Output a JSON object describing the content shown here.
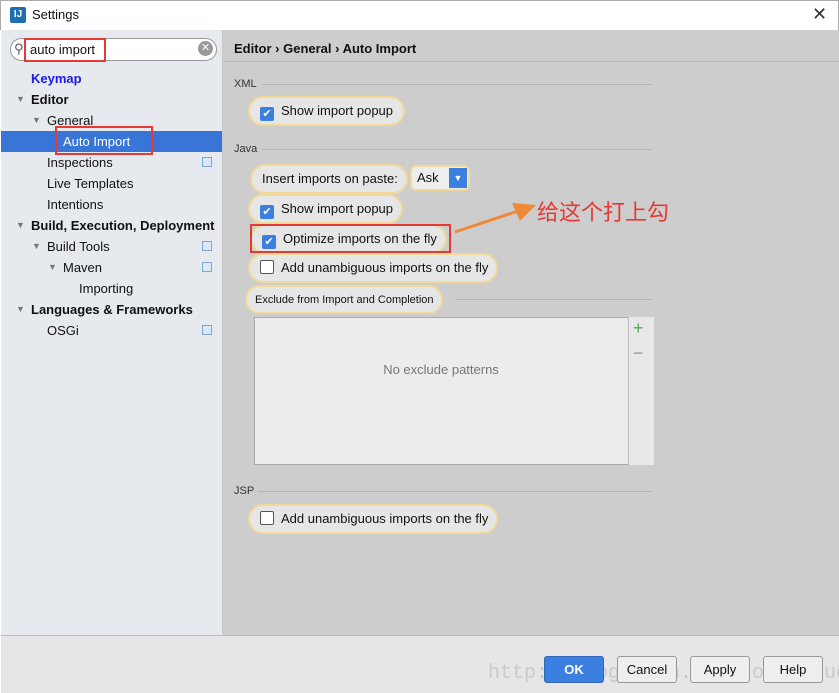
{
  "window": {
    "title": "Settings",
    "close": "✕"
  },
  "search": {
    "value": "auto import"
  },
  "sidebar": {
    "items": [
      {
        "label": "Keymap"
      },
      {
        "label": "Editor"
      },
      {
        "label": "General"
      },
      {
        "label": "Auto Import"
      },
      {
        "label": "Inspections"
      },
      {
        "label": "Live Templates"
      },
      {
        "label": "Intentions"
      },
      {
        "label": "Build, Execution, Deployment"
      },
      {
        "label": "Build Tools"
      },
      {
        "label": "Maven"
      },
      {
        "label": "Importing"
      },
      {
        "label": "Languages & Frameworks"
      },
      {
        "label": "OSGi"
      }
    ]
  },
  "breadcrumb": "Editor › General › Auto Import",
  "xml": {
    "label": "XML",
    "show_popup": {
      "label": "Show import popup",
      "checked": true
    }
  },
  "java": {
    "label": "Java",
    "insert_label": "Insert imports on paste:",
    "insert_value": "Ask",
    "show_popup": {
      "label": "Show import popup",
      "checked": true
    },
    "optimize": {
      "label": "Optimize imports on the fly",
      "checked": true
    },
    "unambiguous": {
      "label": "Add unambiguous imports on the fly",
      "checked": false
    }
  },
  "exclude": {
    "label": "Exclude from Import and Completion",
    "empty": "No exclude patterns",
    "add": "+",
    "remove": "−"
  },
  "jsp": {
    "label": "JSP",
    "unambiguous": {
      "label": "Add unambiguous imports on the fly",
      "checked": false
    }
  },
  "annotation": "给这个打上勾",
  "buttons": {
    "ok": "OK",
    "cancel": "Cancel",
    "apply": "Apply",
    "help": "Help"
  },
  "watermark": "http://blog.csdn.net/totutuzuoquan",
  "colors": {
    "accent": "#3875d7",
    "highlight": "#e53935",
    "arrow": "#f0883a"
  }
}
